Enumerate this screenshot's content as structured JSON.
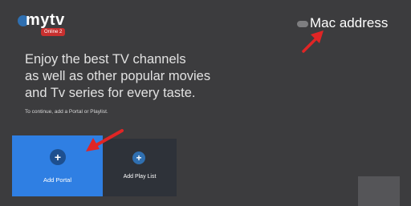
{
  "header": {
    "logo_text": "mytv",
    "logo_badge": "Online 2",
    "mac_label": "Mac address"
  },
  "intro": {
    "tagline_lines": [
      "Enjoy the best TV channels",
      "as well as other popular movies",
      "and Tv series for every taste."
    ],
    "hint": "To continue, add a Portal or Playlist."
  },
  "tiles": [
    {
      "label": "Add Portal",
      "icon": "plus-icon"
    },
    {
      "label": "Add Play List",
      "icon": "plus-icon"
    }
  ],
  "colors": {
    "background": "#3c3c3e",
    "portal_tile": "#2f7fe3",
    "playlist_tile": "#2e3239",
    "arrow": "#e02525"
  }
}
